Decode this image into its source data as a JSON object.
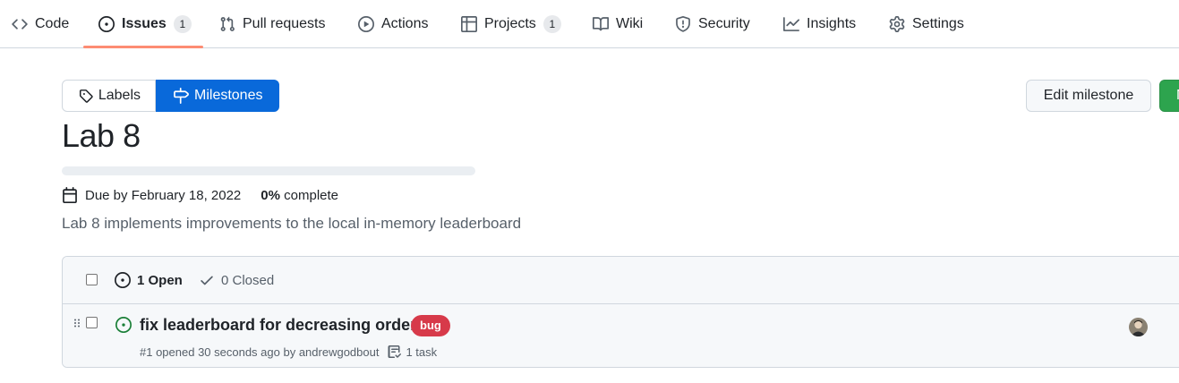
{
  "repo_nav": {
    "tabs": [
      {
        "label": "Code",
        "icon": "code-icon"
      },
      {
        "label": "Issues",
        "icon": "issue-opened-icon",
        "count": "1",
        "selected": true
      },
      {
        "label": "Pull requests",
        "icon": "git-pull-request-icon"
      },
      {
        "label": "Actions",
        "icon": "play-icon"
      },
      {
        "label": "Projects",
        "icon": "table-icon",
        "count": "1"
      },
      {
        "label": "Wiki",
        "icon": "book-icon"
      },
      {
        "label": "Security",
        "icon": "shield-icon"
      },
      {
        "label": "Insights",
        "icon": "graph-icon"
      },
      {
        "label": "Settings",
        "icon": "gear-icon"
      }
    ],
    "selected_underline_color": "#fd8c73"
  },
  "subnav": {
    "labels": "Labels",
    "milestones": "Milestones"
  },
  "actions": {
    "edit_milestone": "Edit milestone",
    "new_issue_partial": "N"
  },
  "milestone": {
    "title": "Lab 8",
    "progress_fraction": 0,
    "due": "Due by February 18, 2022",
    "percent": "0%",
    "percent_suffix": "complete",
    "description": "Lab 8 implements improvements to the local in-memory leaderboard"
  },
  "issues": {
    "open_count": "1 Open",
    "closed_count": "0 Closed",
    "items": [
      {
        "title": "fix leaderboard for decreasing order",
        "label": "bug",
        "label_color": "#d73a4a",
        "meta": "#1 opened 30 seconds ago by",
        "author": "andrewgodbout",
        "tasks": "1 task"
      }
    ]
  },
  "colors": {
    "accent": "#0969da",
    "open_green": "#1a7f37",
    "primary_button": "#2da44e"
  }
}
